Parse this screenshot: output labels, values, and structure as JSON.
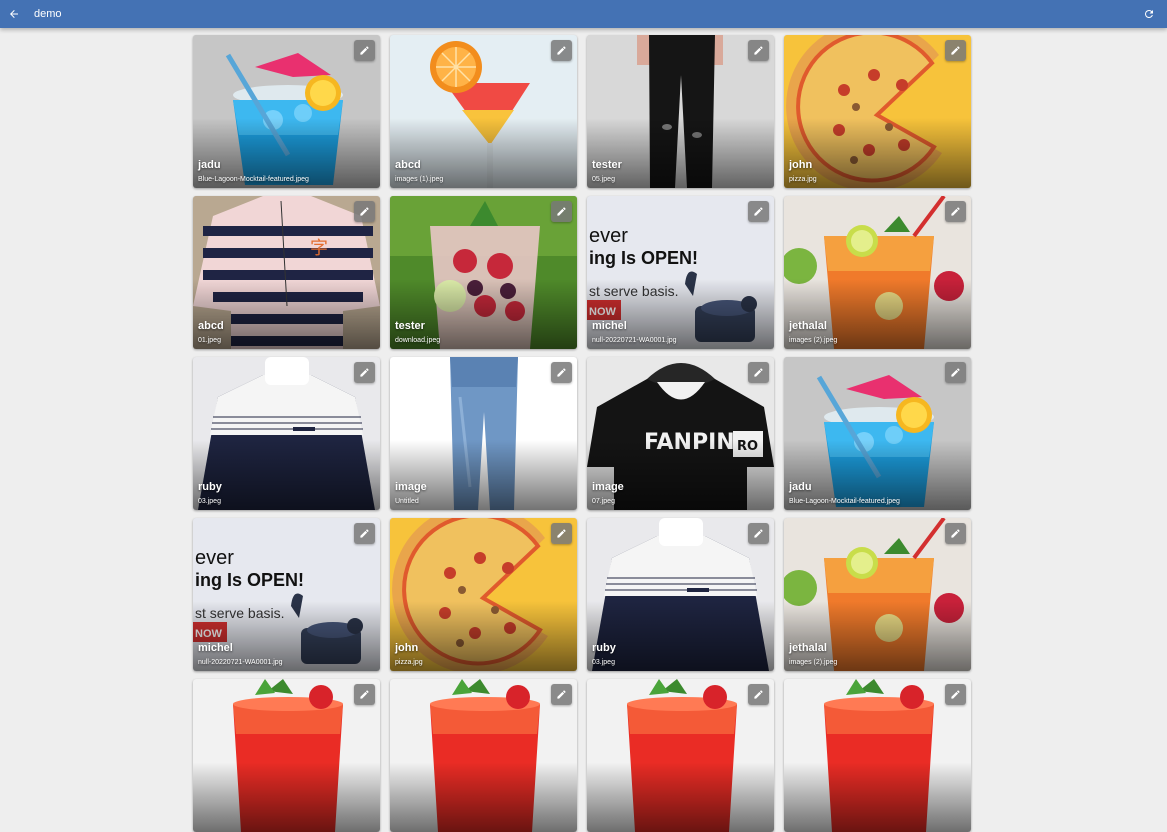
{
  "app": {
    "title": "demo",
    "back_icon": "arrow-left-icon",
    "refresh_icon": "refresh-icon",
    "accent": "#4472b4"
  },
  "cards": [
    {
      "name": "jadu",
      "file": "Blue-Lagoon-Mocktail-featured.jpeg",
      "image": "blue-mocktail"
    },
    {
      "name": "abcd",
      "file": "images (1).jpeg",
      "image": "orange-cocktail"
    },
    {
      "name": "tester",
      "file": "05.jpeg",
      "image": "black-jeans"
    },
    {
      "name": "john",
      "file": "pizza.jpg",
      "image": "pizza"
    },
    {
      "name": "abcd",
      "file": "01.jpeg",
      "image": "striped-shirt"
    },
    {
      "name": "tester",
      "file": "download.jpeg",
      "image": "berry-drink"
    },
    {
      "name": "michel",
      "file": "null-20220721-WA0001.jpg",
      "image": "earbuds-banner"
    },
    {
      "name": "jethalal",
      "file": "images (2).jpeg",
      "image": "orange-lemonade"
    },
    {
      "name": "ruby",
      "file": "03.jpeg",
      "image": "sweatshirt"
    },
    {
      "name": "image",
      "file": "Untitled",
      "image": "blue-jeans"
    },
    {
      "name": "image",
      "file": "07.jpeg",
      "image": "black-hoodie"
    },
    {
      "name": "jadu",
      "file": "Blue-Lagoon-Mocktail-featured.jpeg",
      "image": "blue-mocktail"
    },
    {
      "name": "michel",
      "file": "null-20220721-WA0001.jpg",
      "image": "earbuds-banner"
    },
    {
      "name": "john",
      "file": "pizza.jpg",
      "image": "pizza"
    },
    {
      "name": "ruby",
      "file": "03.jpeg",
      "image": "sweatshirt"
    },
    {
      "name": "jethalal",
      "file": "images (2).jpeg",
      "image": "orange-lemonade"
    },
    {
      "name": "",
      "file": "",
      "image": "red-drink"
    },
    {
      "name": "",
      "file": "",
      "image": "red-drink"
    },
    {
      "name": "",
      "file": "",
      "image": "red-drink"
    },
    {
      "name": "",
      "file": "",
      "image": "red-drink"
    }
  ],
  "banner_text": {
    "line1": "ever",
    "line2": "ing Is OPEN!",
    "line3": "st serve basis.",
    "badge": "NOW"
  },
  "hoodie_text": {
    "word": "FANPIN",
    "patch": "RO"
  },
  "shirt_text": {
    "glyph": "字"
  }
}
